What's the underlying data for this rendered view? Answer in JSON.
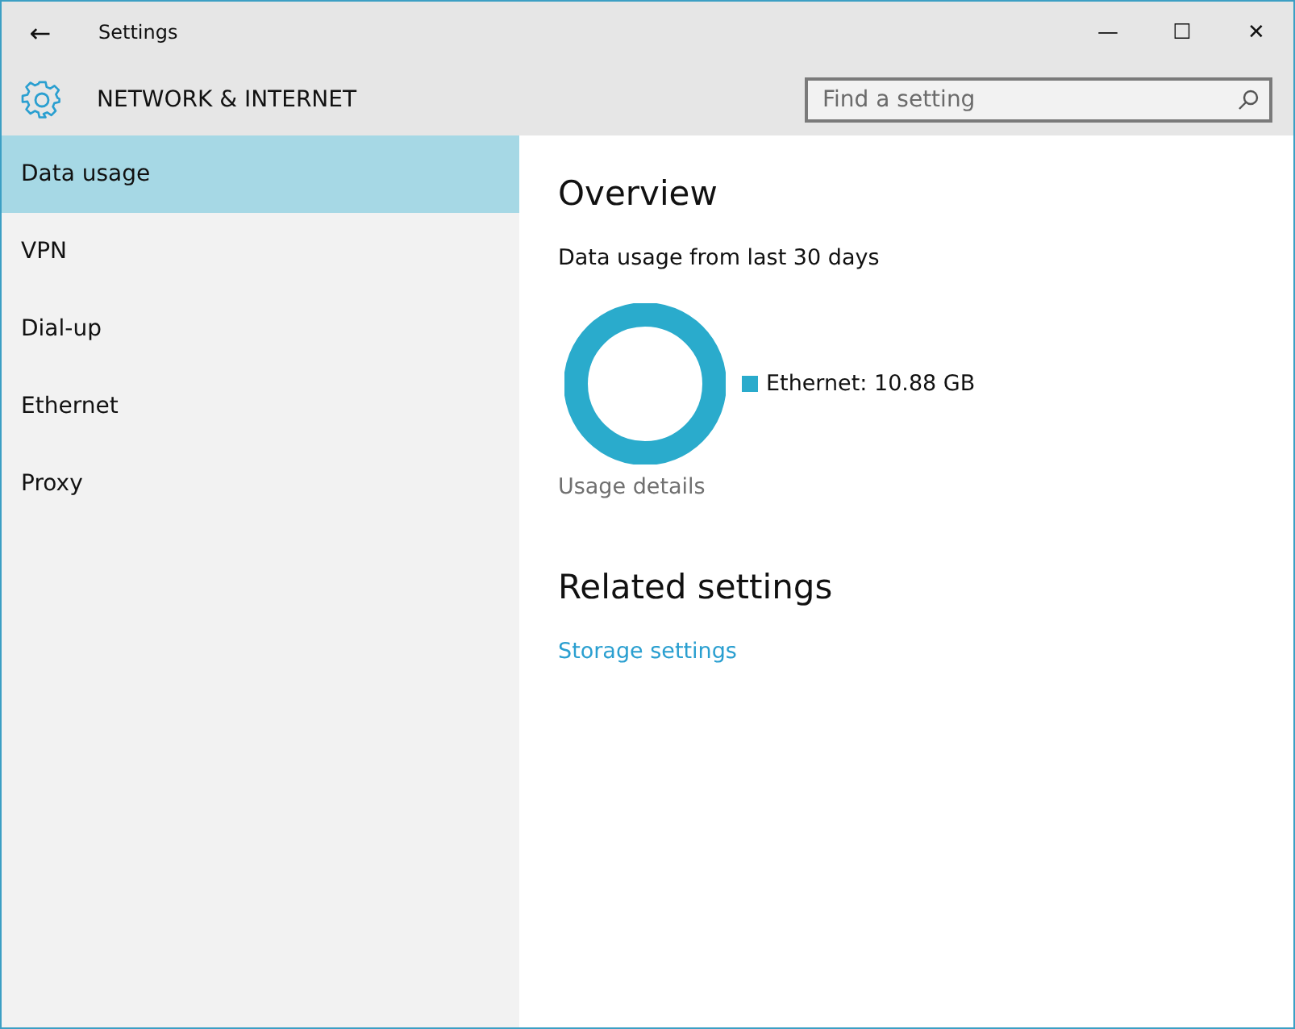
{
  "window": {
    "title": "Settings",
    "back": "←",
    "controls": [
      "—",
      "☐",
      "✕"
    ]
  },
  "header": {
    "title": "NETWORK & INTERNET",
    "search": {
      "placeholder": "Find a setting"
    }
  },
  "sidebar": {
    "items": [
      {
        "label": "Data usage",
        "selected": true
      },
      {
        "label": "VPN",
        "selected": false
      },
      {
        "label": "Dial-up",
        "selected": false
      },
      {
        "label": "Ethernet",
        "selected": false
      },
      {
        "label": "Proxy",
        "selected": false
      }
    ]
  },
  "content": {
    "overview_title": "Overview",
    "usage_caption": "Data usage from last 30 days",
    "legend": [
      {
        "label": "Ethernet: 10.88 GB",
        "color": "#2aabcc"
      }
    ],
    "usage_details": "Usage details",
    "related_title": "Related settings",
    "related_links": [
      "Storage settings"
    ]
  }
}
